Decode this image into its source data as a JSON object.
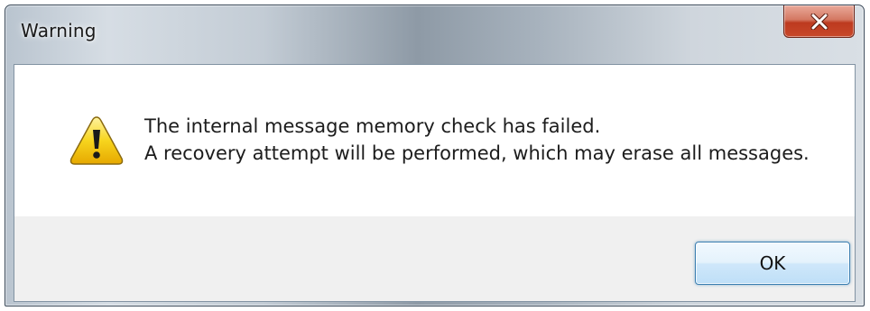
{
  "window": {
    "title": "Warning",
    "close_icon": "close-icon",
    "accent_color": "#c8482a"
  },
  "dialog": {
    "icon": "warning-icon",
    "message_line1": "The internal message memory check has failed.",
    "message_line2": "A recovery attempt will be performed, which may erase all messages."
  },
  "buttons": {
    "ok_label": "OK"
  }
}
